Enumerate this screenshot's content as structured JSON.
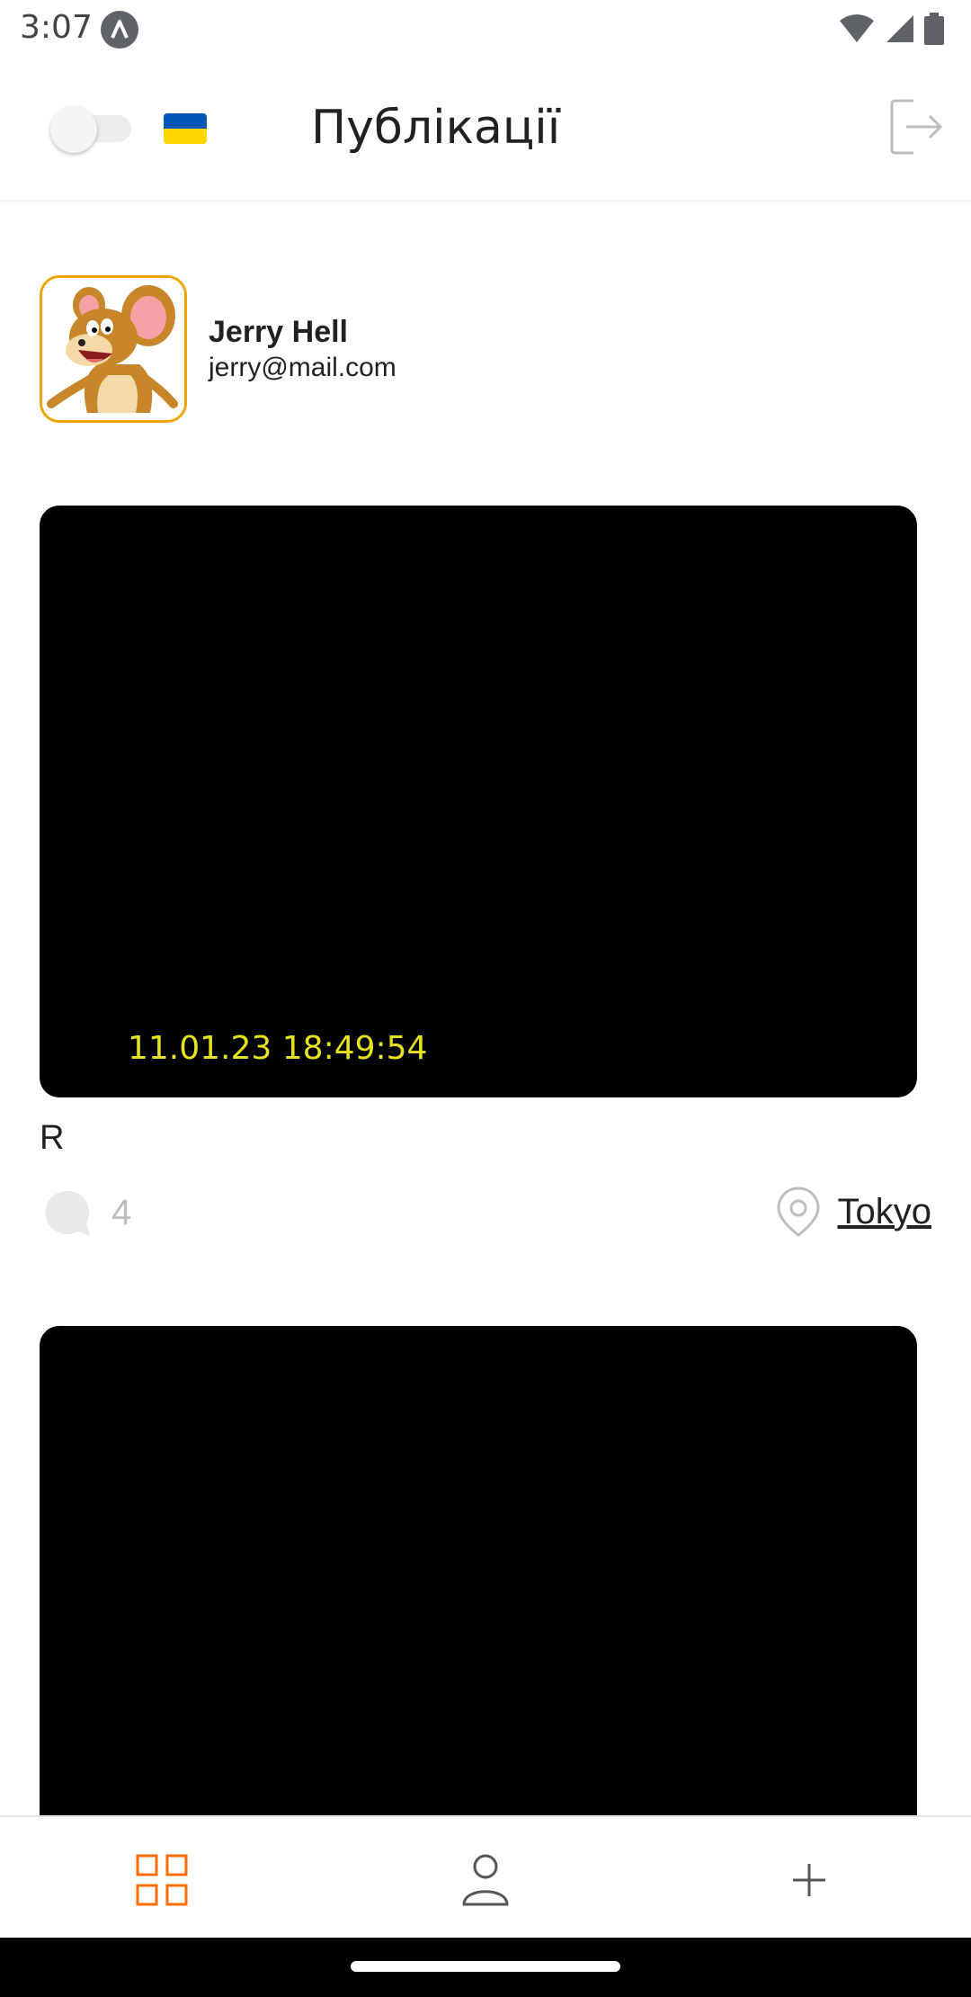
{
  "status_bar": {
    "time": "3:07"
  },
  "header": {
    "title": "Публікації",
    "flag_colors": [
      "#0057B7",
      "#FFD700"
    ]
  },
  "profile": {
    "name": "Jerry Hell",
    "email": "jerry@mail.com"
  },
  "posts": [
    {
      "timestamp": "11.01.23 18:49:54",
      "title": "R",
      "comments_count": "4",
      "location": "Tokyo"
    }
  ],
  "bottom_nav": {
    "items": [
      "grid-icon",
      "user-icon",
      "plus-icon"
    ],
    "active_color": "#FF6C00"
  },
  "colors": {
    "accent": "#FF6C00",
    "avatar_border": "#F0A500",
    "timestamp": "#E6E21E"
  }
}
